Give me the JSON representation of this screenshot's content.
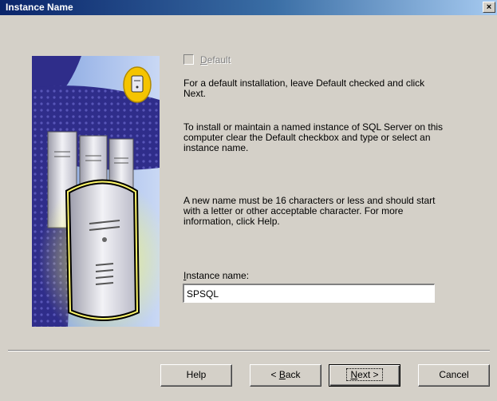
{
  "window": {
    "title": "Instance Name",
    "close_symbol": "×"
  },
  "default_option": {
    "label_underlined": "D",
    "label_rest": "efault",
    "checked": false,
    "enabled": false
  },
  "paragraphs": [
    "For a default installation, leave Default checked and click Next.",
    "To install or maintain a named instance of SQL Server on this computer clear the Default checkbox and type or select an instance name.",
    "A new name must be 16 characters or less and should start with a letter or other acceptable character.  For more information, click Help."
  ],
  "instance_field": {
    "label_underlined": "I",
    "label_rest": "nstance name:",
    "value": "SPSQL"
  },
  "buttons": {
    "help": "Help",
    "back_prefix": "< ",
    "back_underlined": "B",
    "back_rest": "ack",
    "next_underlined": "N",
    "next_rest": "ext >",
    "cancel": "Cancel"
  },
  "icons": {
    "graphic": "sql-server-computers-illustration",
    "close": "close-icon",
    "badge": "server-badge-icon"
  },
  "colors": {
    "dialog_bg": "#d4d0c8",
    "titlebar_start": "#0a246a",
    "titlebar_end": "#a6caf0",
    "graphic_purple": "#2f2d8a",
    "graphic_light": "#7fa0dc",
    "badge_yellow": "#f5c400"
  }
}
